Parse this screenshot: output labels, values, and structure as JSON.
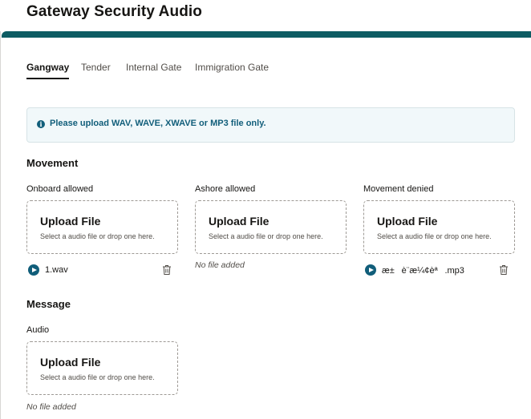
{
  "page": {
    "title": "Gateway Security Audio"
  },
  "tabs": [
    {
      "label": "Gangway",
      "active": true
    },
    {
      "label": "Tender",
      "active": false
    },
    {
      "label": "Internal Gate",
      "active": false
    },
    {
      "label": "Immigration Gate",
      "active": false
    }
  ],
  "info": {
    "text": "Please upload WAV, WAVE, XWAVE or MP3 file only.",
    "icon": "info-icon"
  },
  "movement": {
    "title": "Movement",
    "onboard": {
      "label": "Onboard allowed",
      "upload_title": "Upload File",
      "upload_desc": "Select a audio file or drop one here.",
      "file_name": "1.wav"
    },
    "ashore": {
      "label": "Ashore allowed",
      "upload_title": "Upload File",
      "upload_desc": "Select a audio file or drop one here.",
      "empty_text": "No file added"
    },
    "denied": {
      "label": "Movement denied",
      "upload_title": "Upload File",
      "upload_desc": "Select a audio file or drop one here.",
      "file_name": "æ±è¨æ¼¢èª.mp3"
    }
  },
  "message": {
    "title": "Message",
    "audio": {
      "label": "Audio",
      "upload_title": "Upload File",
      "upload_desc": "Select a audio file or drop one here.",
      "empty_text": "No file added"
    }
  },
  "colors": {
    "accent": "#0d5c63",
    "info": "#115e7a",
    "banner_bg": "#f1f8fa"
  }
}
